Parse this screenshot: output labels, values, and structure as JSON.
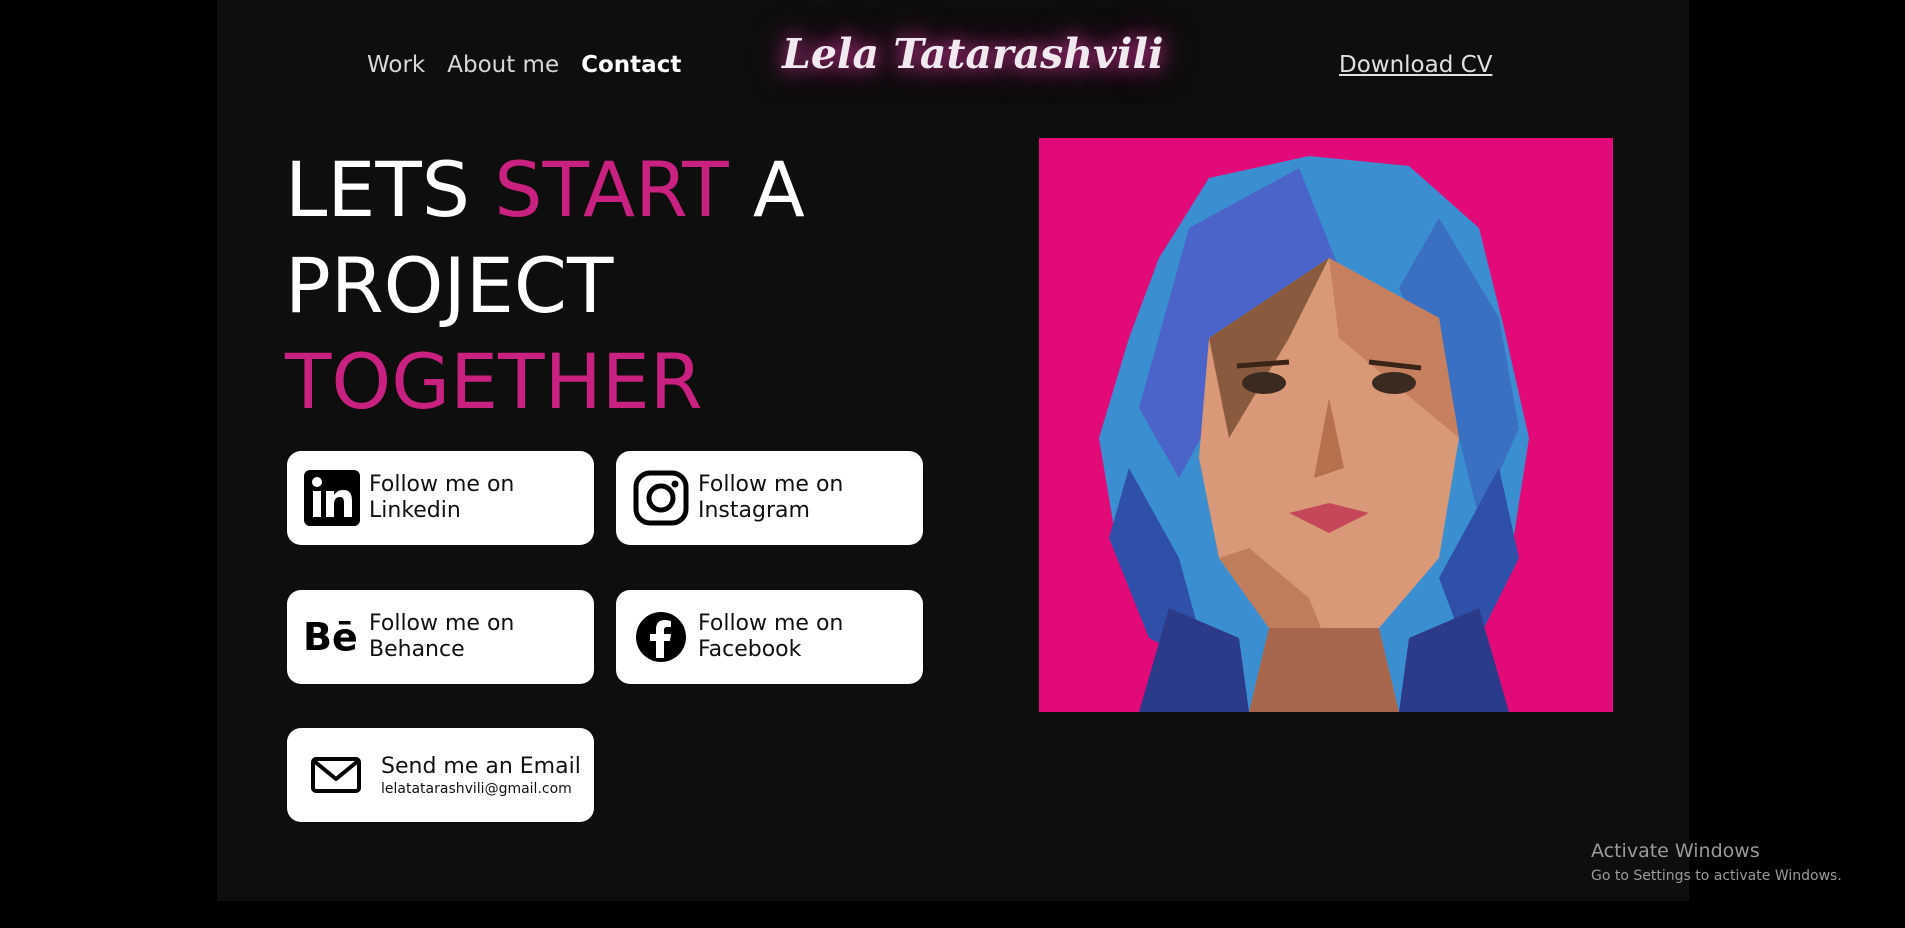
{
  "header": {
    "nav": [
      {
        "label": "Work"
      },
      {
        "label": "About me"
      },
      {
        "label": "Contact"
      }
    ],
    "brand": "Lela Tatarashvili",
    "download_label": "Download CV"
  },
  "hero": {
    "line1_a": "LETS",
    "line1_b": "START",
    "line1_c": "A",
    "line2": "PROJECT",
    "line3": "TOGETHER"
  },
  "socials": [
    {
      "label_1": "Follow me on",
      "label_2": "Linkedin",
      "icon": "linkedin-icon"
    },
    {
      "label_1": "Follow me on",
      "label_2": "Instagram",
      "icon": "instagram-icon"
    },
    {
      "label_1": "Follow me on",
      "label_2": "Behance",
      "icon": "behance-icon"
    },
    {
      "label_1": "Follow me on",
      "label_2": "Facebook",
      "icon": "facebook-icon"
    }
  ],
  "email": {
    "title": "Send me an Email",
    "address": "lelatatarashvili@gmail.com",
    "icon": "mail-icon"
  },
  "watermark": {
    "title": "Activate Windows",
    "subtitle": "Go to Settings to activate Windows."
  },
  "colors": {
    "accent": "#c9217f",
    "background": "#0e0e0e",
    "portrait_bg": "#e20a78"
  }
}
